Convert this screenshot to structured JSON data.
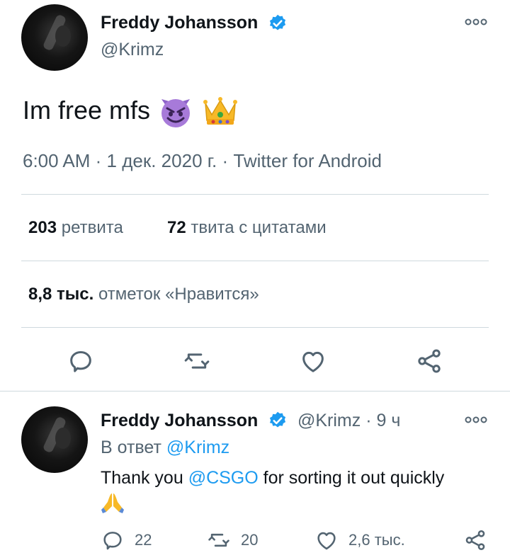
{
  "main_tweet": {
    "author_name": "Freddy Johansson",
    "author_handle": "@Krimz",
    "text": "Im free mfs",
    "emojis": [
      "smiling-devil",
      "crown"
    ],
    "time": "6:00 AM",
    "date": "1 дек. 2020 г.",
    "client": "Twitter for Android",
    "sep": "·",
    "retweets_count": "203",
    "retweets_label": "ретвита",
    "quotes_count": "72",
    "quotes_label": "твита с цитатами",
    "likes_count": "8,8 тыс.",
    "likes_label": "отметок «Нравится»"
  },
  "reply_tweet": {
    "author_name": "Freddy Johansson",
    "author_handle": "@Krimz",
    "time_ago": "9 ч",
    "sep": "·",
    "reply_to_prefix": "В ответ",
    "reply_to_handle": "@Krimz",
    "text_before": "Thank you ",
    "text_mention": "@CSGO",
    "text_after": " for sorting it out quickly",
    "text_emoji": "folded-hands",
    "reply_count": "22",
    "retweet_count": "20",
    "like_count": "2,6 тыс."
  },
  "colors": {
    "accent": "#1d9bf0",
    "secondary_text": "#536471",
    "divider": "#cfd9de"
  }
}
